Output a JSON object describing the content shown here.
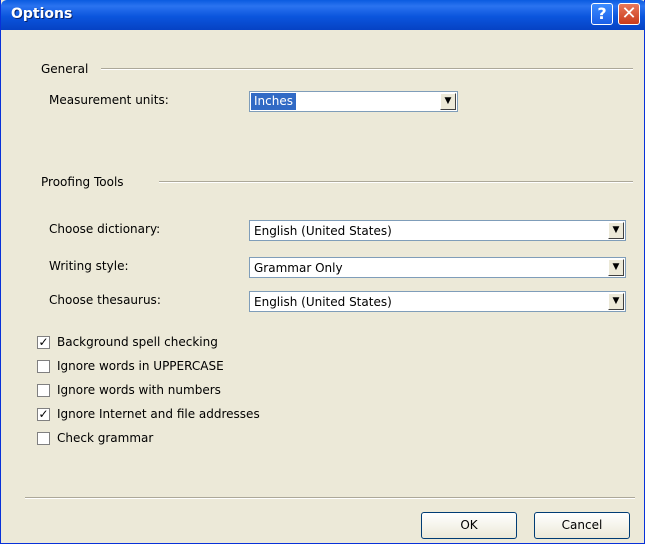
{
  "window": {
    "title": "Options"
  },
  "titlebar": {
    "help_glyph": "?",
    "close_glyph": "✕"
  },
  "general": {
    "heading": "General",
    "measurement_label": "Measurement units:",
    "measurement_value": "Inches"
  },
  "proofing": {
    "heading": "Proofing Tools",
    "dictionary_label": "Choose dictionary:",
    "dictionary_value": "English (United States)",
    "style_label": "Writing style:",
    "style_value": "Grammar Only",
    "thesaurus_label": "Choose thesaurus:",
    "thesaurus_value": "English (United States)"
  },
  "checkboxes": [
    {
      "label": "Background spell checking",
      "mark": "✓",
      "checked": true
    },
    {
      "label": "Ignore words in UPPERCASE",
      "mark": "",
      "checked": false
    },
    {
      "label": "Ignore words with numbers",
      "mark": "",
      "checked": false
    },
    {
      "label": "Ignore Internet and file addresses",
      "mark": "✓",
      "checked": true
    },
    {
      "label": "Check grammar",
      "mark": "",
      "checked": false
    }
  ],
  "buttons": {
    "ok": "OK",
    "cancel": "Cancel"
  },
  "colors": {
    "titlebar": "#0a5be0",
    "face": "#ece9d8",
    "selection": "#316ac5"
  }
}
